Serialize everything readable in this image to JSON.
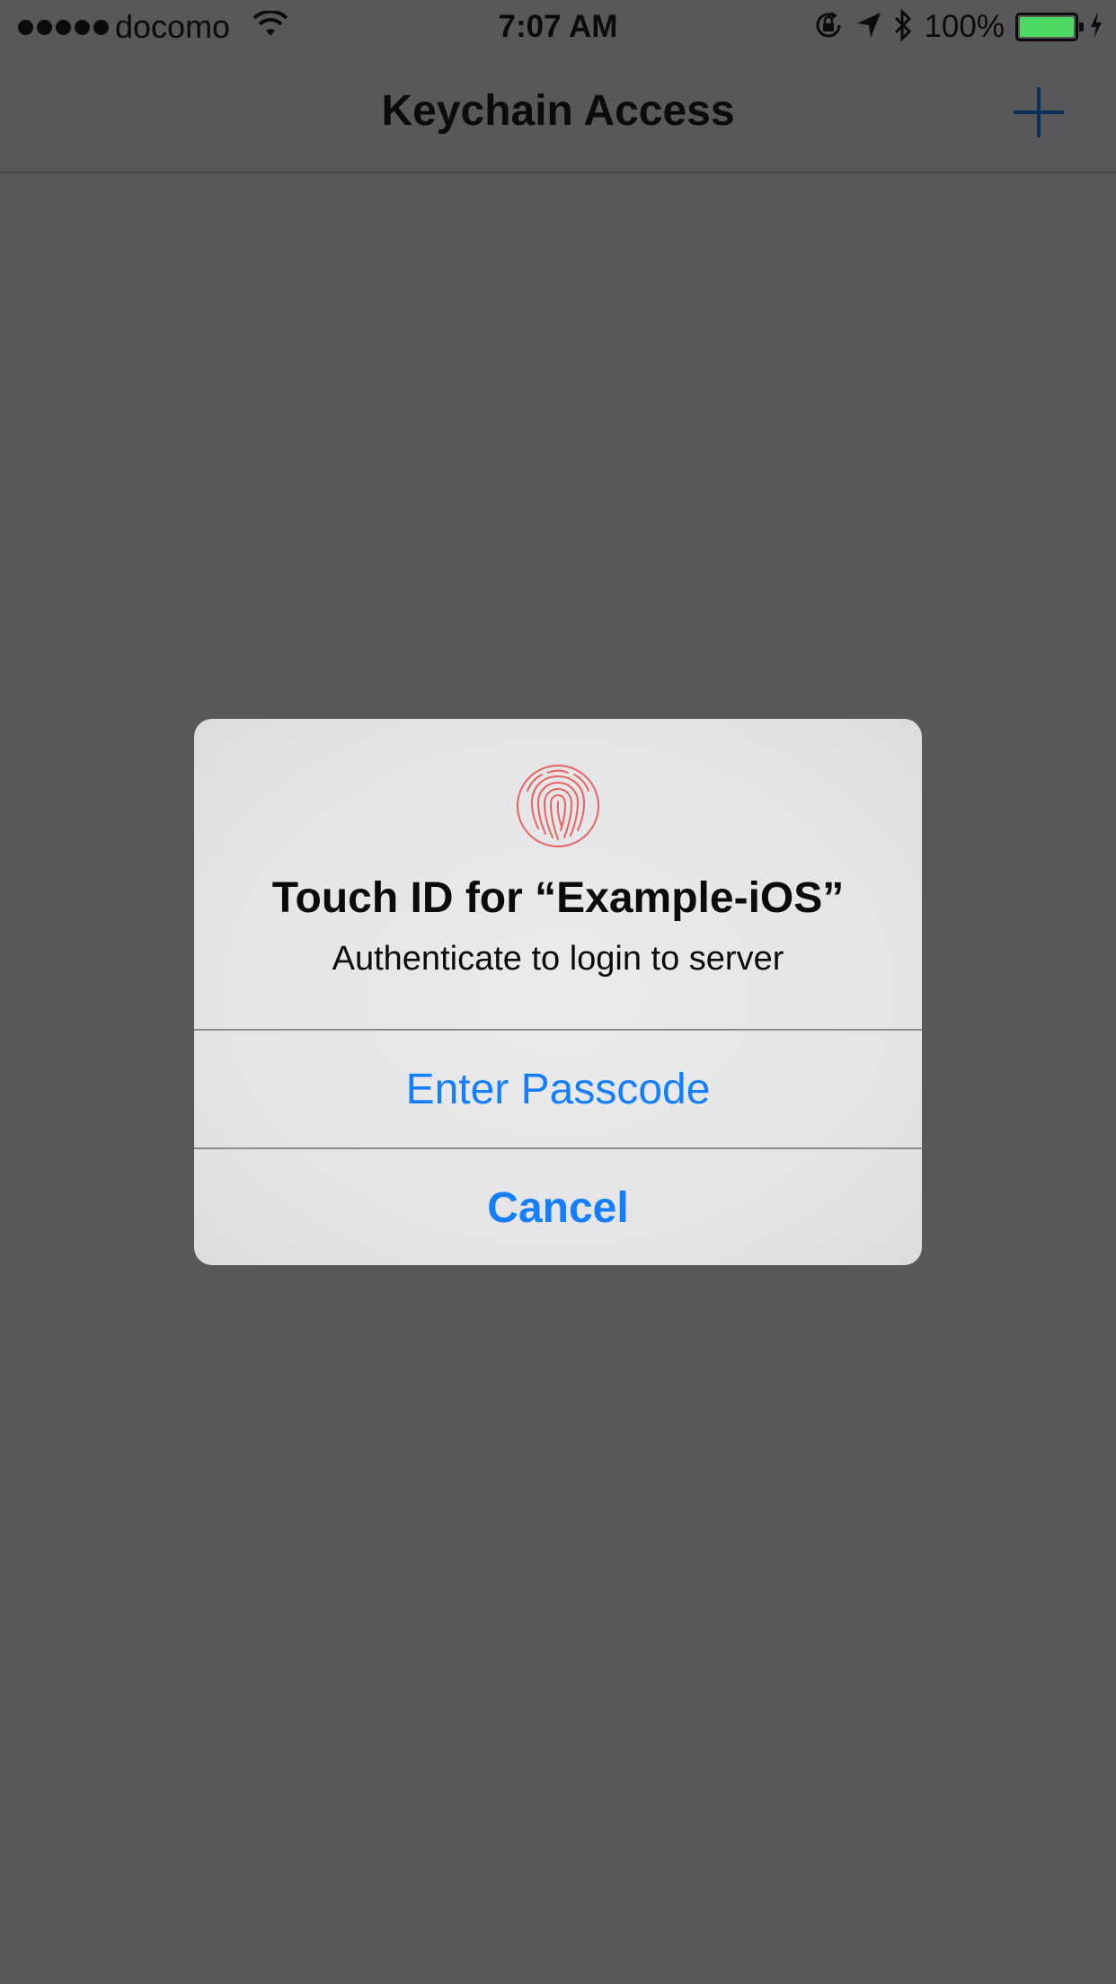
{
  "status_bar": {
    "carrier": "docomo",
    "time": "7:07 AM",
    "battery_percent": "100%",
    "battery_level": 1.0,
    "battery_color": "#4cd964"
  },
  "nav_bar": {
    "title": "Keychain Access",
    "add_icon": "plus-icon",
    "accent_color": "#0c2f5c"
  },
  "alert": {
    "icon": "fingerprint-icon",
    "icon_color": "#e8625f",
    "title": "Touch ID for “Example-iOS”",
    "message": "Authenticate to login to server",
    "buttons": [
      {
        "label": "Enter Passcode",
        "style": "default"
      },
      {
        "label": "Cancel",
        "style": "bold"
      }
    ],
    "button_color": "#157efb"
  },
  "background_color": "#58585a"
}
